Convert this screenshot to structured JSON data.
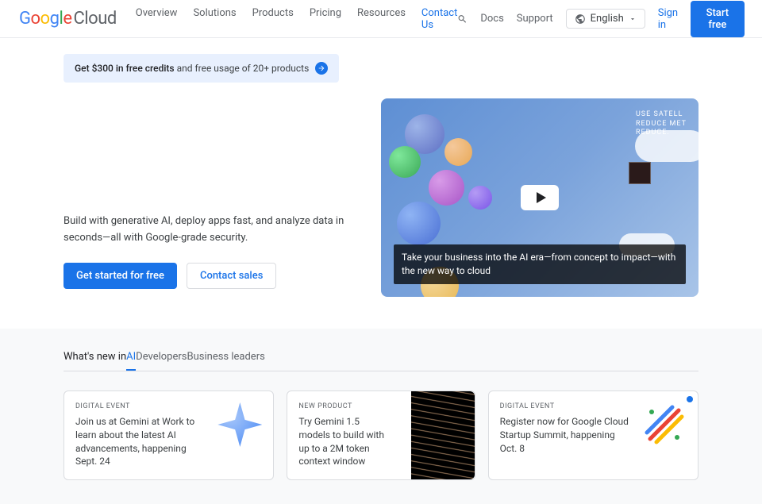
{
  "header": {
    "logo_cloud": "Cloud",
    "nav": [
      "Overview",
      "Solutions",
      "Products",
      "Pricing",
      "Resources",
      "Contact Us"
    ],
    "docs": "Docs",
    "support": "Support",
    "language": "English",
    "signin": "Sign in",
    "start_free": "Start free"
  },
  "promo": {
    "bold": "Get $300 in free credits",
    "rest": " and free usage of 20+ products"
  },
  "hero": {
    "desc": "Build with generative AI, deploy apps fast, and analyze data in seconds—all with Google-grade security.",
    "get_started": "Get started for free",
    "contact_sales": "Contact sales",
    "video_overlay_line1": "USE SATELL",
    "video_overlay_line2": "REDUCE MET",
    "video_overlay_line3": "REDUCE.",
    "caption": "Take your business into the AI era—from concept to impact—with the new way to cloud"
  },
  "whatsnew": {
    "label": "What's new in ",
    "tabs": [
      "AI",
      "Developers",
      "Business leaders"
    ]
  },
  "cards": [
    {
      "eyebrow": "DIGITAL EVENT",
      "text": "Join us at Gemini at Work to learn about the latest AI advancements, happening Sept. 24"
    },
    {
      "eyebrow": "NEW PRODUCT",
      "text": "Try Gemini 1.5 models to build with up to a 2M token context window"
    },
    {
      "eyebrow": "DIGITAL EVENT",
      "text": "Register now for Google Cloud Startup Summit, happening Oct. 8"
    }
  ]
}
